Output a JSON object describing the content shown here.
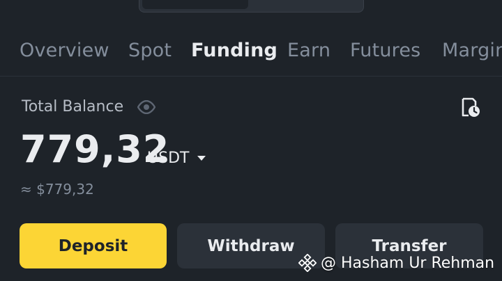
{
  "tabs": [
    {
      "label": "Overview"
    },
    {
      "label": "Spot"
    },
    {
      "label": "Funding"
    },
    {
      "label": "Earn"
    },
    {
      "label": "Futures"
    },
    {
      "label": "Margin"
    }
  ],
  "active_tab": "Funding",
  "balance": {
    "label": "Total Balance",
    "value": "779,32",
    "currency": "USDT",
    "approx": "≈ $779,32"
  },
  "actions": {
    "deposit": "Deposit",
    "withdraw": "Withdraw",
    "transfer": "Transfer"
  },
  "watermark": {
    "text": "@ Hasham Ur Rehman"
  },
  "icons": {
    "eye": "eye-icon",
    "history": "history-icon",
    "caret": "caret-down-icon",
    "logo": "binance-logo-icon"
  },
  "colors": {
    "background": "#1e2329",
    "accent": "#fcd535",
    "muted": "#848e9c",
    "text": "#eaecef",
    "surface": "#2b3139"
  }
}
